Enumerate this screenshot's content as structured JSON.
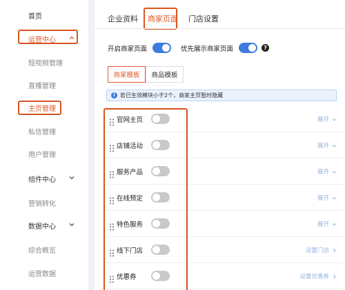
{
  "sidebar": {
    "items": [
      {
        "label": "首页"
      },
      {
        "label": "运营中心"
      },
      {
        "label": "短视频管理"
      },
      {
        "label": "直播管理"
      },
      {
        "label": "主页管理"
      },
      {
        "label": "私信管理"
      },
      {
        "label": "用户管理"
      },
      {
        "label": "组件中心"
      },
      {
        "label": "营销转化"
      },
      {
        "label": "数据中心"
      },
      {
        "label": "综合概览"
      },
      {
        "label": "运营数据"
      }
    ]
  },
  "tabs": [
    {
      "label": "企业资料"
    },
    {
      "label": "商家页面"
    },
    {
      "label": "门店设置"
    }
  ],
  "settings": {
    "enable_label": "开启商家页面",
    "priority_label": "优先展示商家页面",
    "help_glyph": "?"
  },
  "subtabs": [
    {
      "label": "商家模板"
    },
    {
      "label": "商品模板"
    }
  ],
  "notice": {
    "icon": "i",
    "text": "若已生效模块小于2个，商家主页暂时隐藏"
  },
  "modules": [
    {
      "label": "官网主页",
      "action": "展开"
    },
    {
      "label": "店铺活动",
      "action": "展开"
    },
    {
      "label": "服务产品",
      "action": "展开"
    },
    {
      "label": "在线预定",
      "action": "展开"
    },
    {
      "label": "特色服务",
      "action": "展开"
    },
    {
      "label": "线下门店",
      "action": "设置门店"
    },
    {
      "label": "优惠券",
      "action": "设置优惠券"
    }
  ],
  "colors": {
    "accent": "#e05a2b",
    "highlight_border": "#d9531e",
    "toggle_on": "#3d7bde",
    "toggle_off": "#c9c9c9",
    "link": "#9ab6e0"
  }
}
